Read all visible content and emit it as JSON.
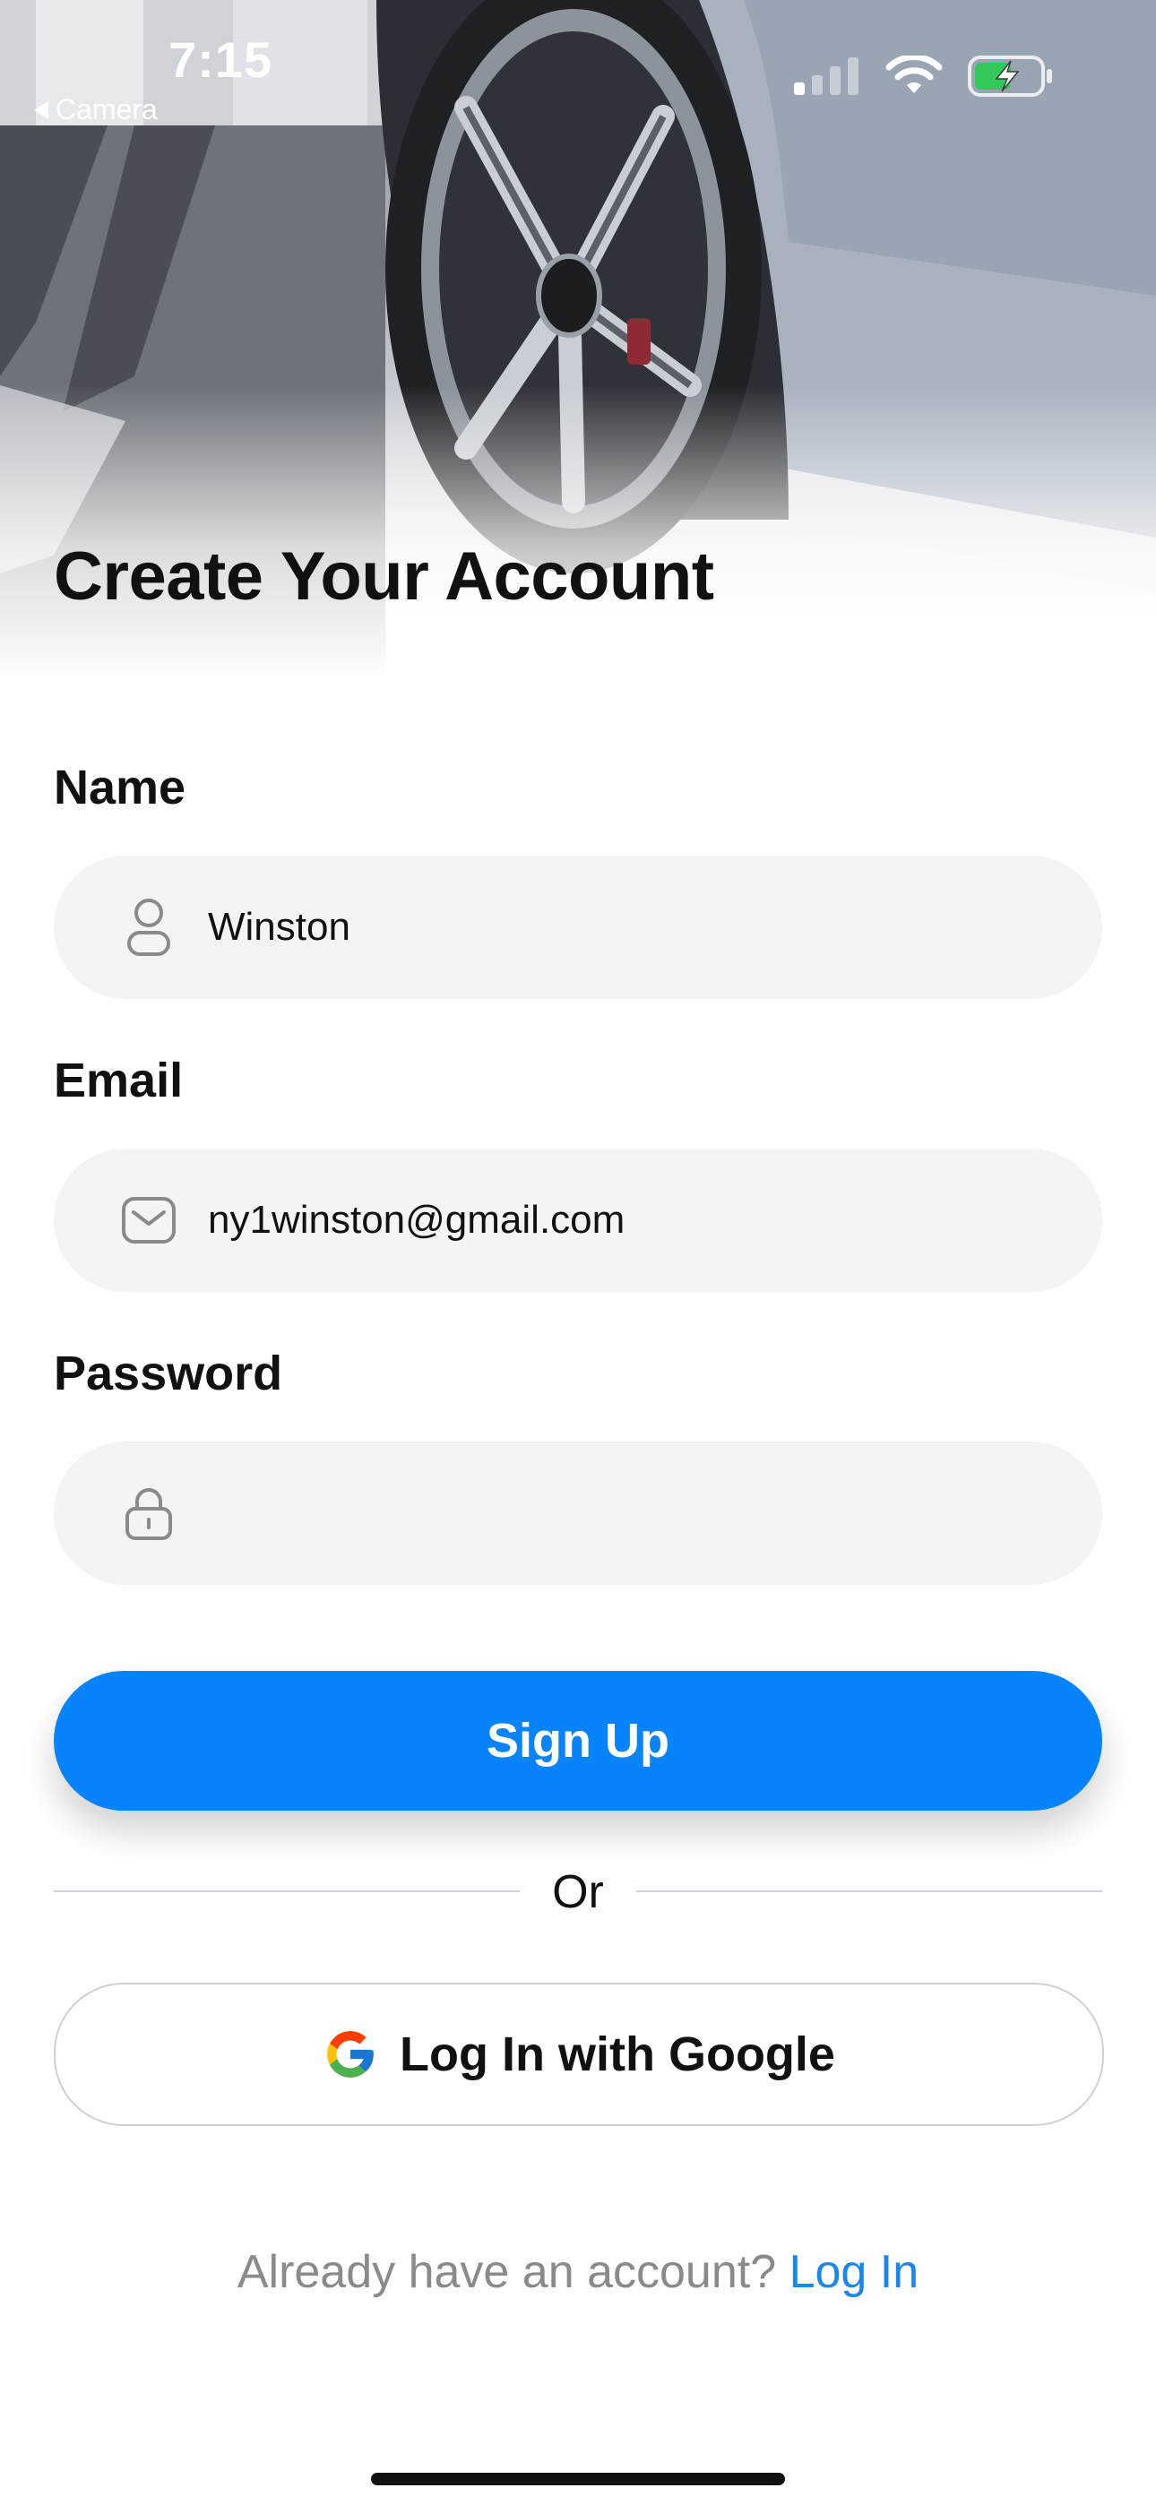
{
  "status_bar": {
    "time": "7:15",
    "back_label": "Camera"
  },
  "page": {
    "title": "Create Your Account"
  },
  "form": {
    "name": {
      "label": "Name",
      "value": "Winston",
      "icon": "person-icon"
    },
    "email": {
      "label": "Email",
      "value": "ny1winston@gmail.com",
      "icon": "mail-icon"
    },
    "password": {
      "label": "Password",
      "value": "",
      "icon": "lock-icon"
    }
  },
  "actions": {
    "signup_label": "Sign Up",
    "divider_text": "Or",
    "google_label": "Log In with Google"
  },
  "footer": {
    "prompt": "Already have an account?",
    "login_link": "Log In"
  },
  "colors": {
    "primary": "#0784fc",
    "link": "#1a86f0",
    "field_bg": "#f4f4f4",
    "battery_fill": "#34c759"
  }
}
